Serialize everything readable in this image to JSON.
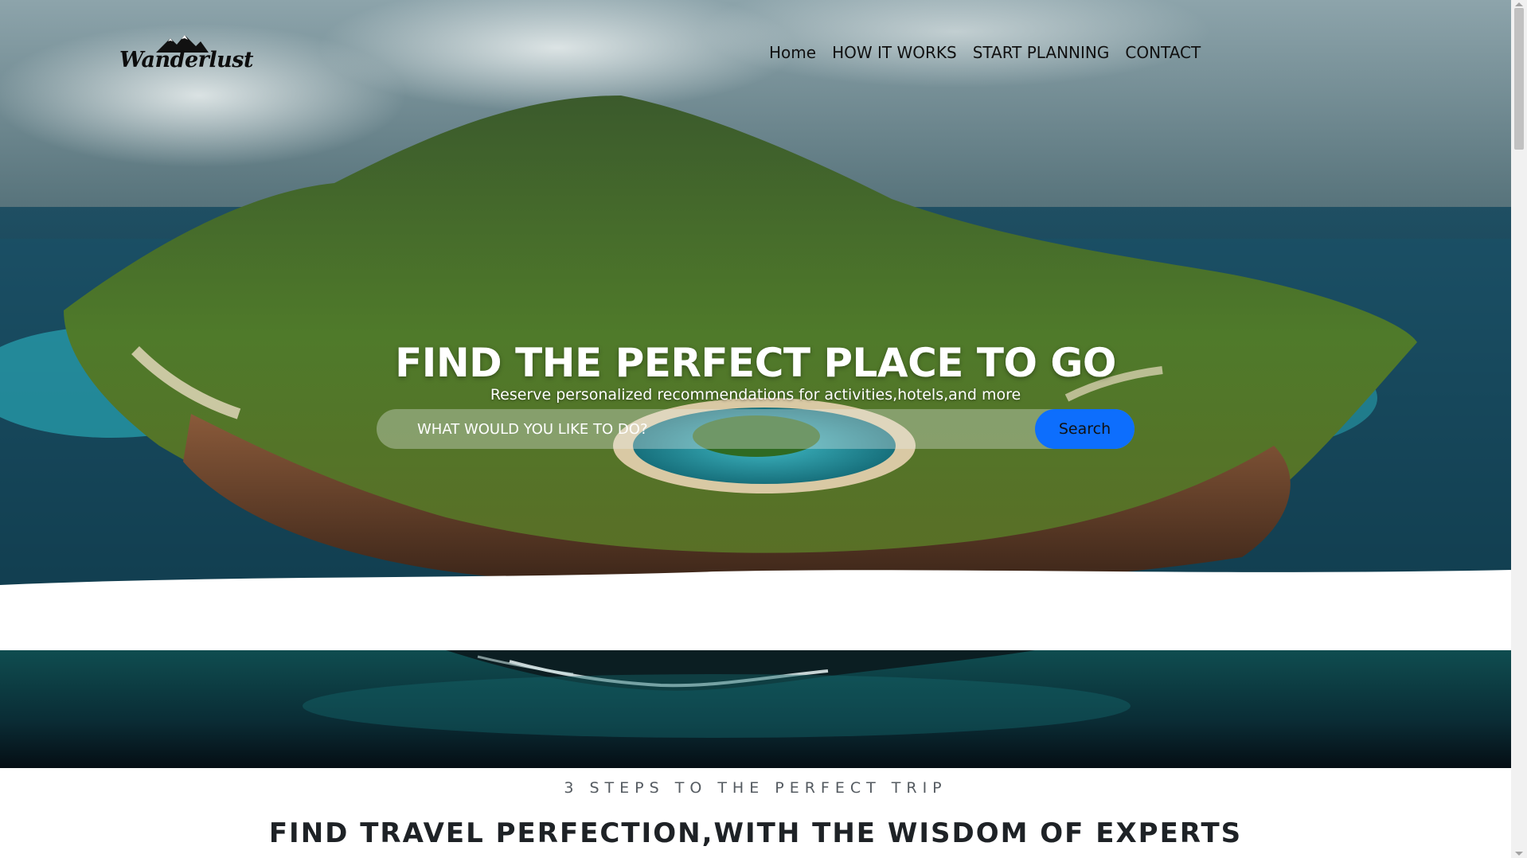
{
  "brand": {
    "logo_text": "Wanderlust"
  },
  "nav": {
    "items": [
      {
        "label": "Home"
      },
      {
        "label": "HOW IT WORKS"
      },
      {
        "label": "START PLANNING"
      },
      {
        "label": "CONTACT"
      }
    ]
  },
  "hero": {
    "title": "FIND THE PERFECT PLACE TO GO",
    "subtitle": "Reserve personalized recommendations for activities,hotels,and more",
    "search": {
      "placeholder": "WHAT WOULD YOU LIKE TO DO?",
      "button_label": "Search"
    }
  },
  "steps": {
    "kicker": "3 STEPS TO THE PERFECT TRIP",
    "heading": "FIND TRAVEL PERFECTION,WITH THE WISDOM OF EXPERTS"
  },
  "colors": {
    "accent": "#0d6efd",
    "nav_text": "#111111",
    "hero_text": "#ffffff",
    "kicker_text": "#555b61"
  }
}
